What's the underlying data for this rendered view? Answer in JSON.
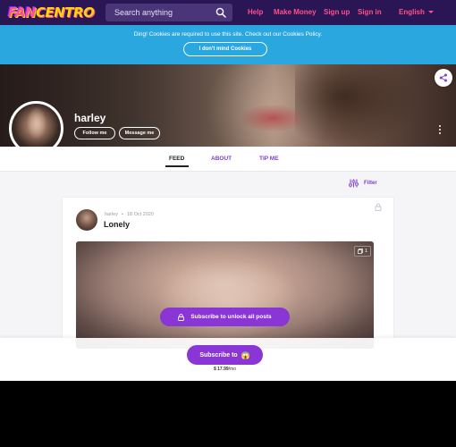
{
  "brand": {
    "logo_text_a": "FAN",
    "logo_text_b": "CENTRO"
  },
  "nav": {
    "search_placeholder": "Search anything",
    "help": "Help",
    "make_money": "Make Money",
    "sign_up": "Sign up",
    "sign_in": "Sign in",
    "language": "English"
  },
  "cookies": {
    "message": "Ding! Cookies are required to use this site. Check out our Cookies Policy.",
    "button": "I don't mind Cookies"
  },
  "profile": {
    "username": "harley",
    "follow_label": "Follow me",
    "message_label": "Message me"
  },
  "tabs": [
    {
      "label": "FEED",
      "active": true
    },
    {
      "label": "ABOUT",
      "active": false
    },
    {
      "label": "TIP ME",
      "active": false
    }
  ],
  "filter": {
    "label": "Filter"
  },
  "post": {
    "author": "harley",
    "date": "18 Oct 2020",
    "title": "Lonely",
    "media_count": "1",
    "unlock_label": "Subscribe to unlock all posts"
  },
  "subscribe": {
    "label": "Subscribe to",
    "emoji": "😱",
    "price": "$ 17.99",
    "period": "/mo"
  },
  "colors": {
    "nav_bg": "#2a1655",
    "accent_pink": "#ff4f8b",
    "cookie_bg": "#2ba7e0",
    "primary_purple": "#8a35d6",
    "tab_purple": "#7e3fd0"
  }
}
